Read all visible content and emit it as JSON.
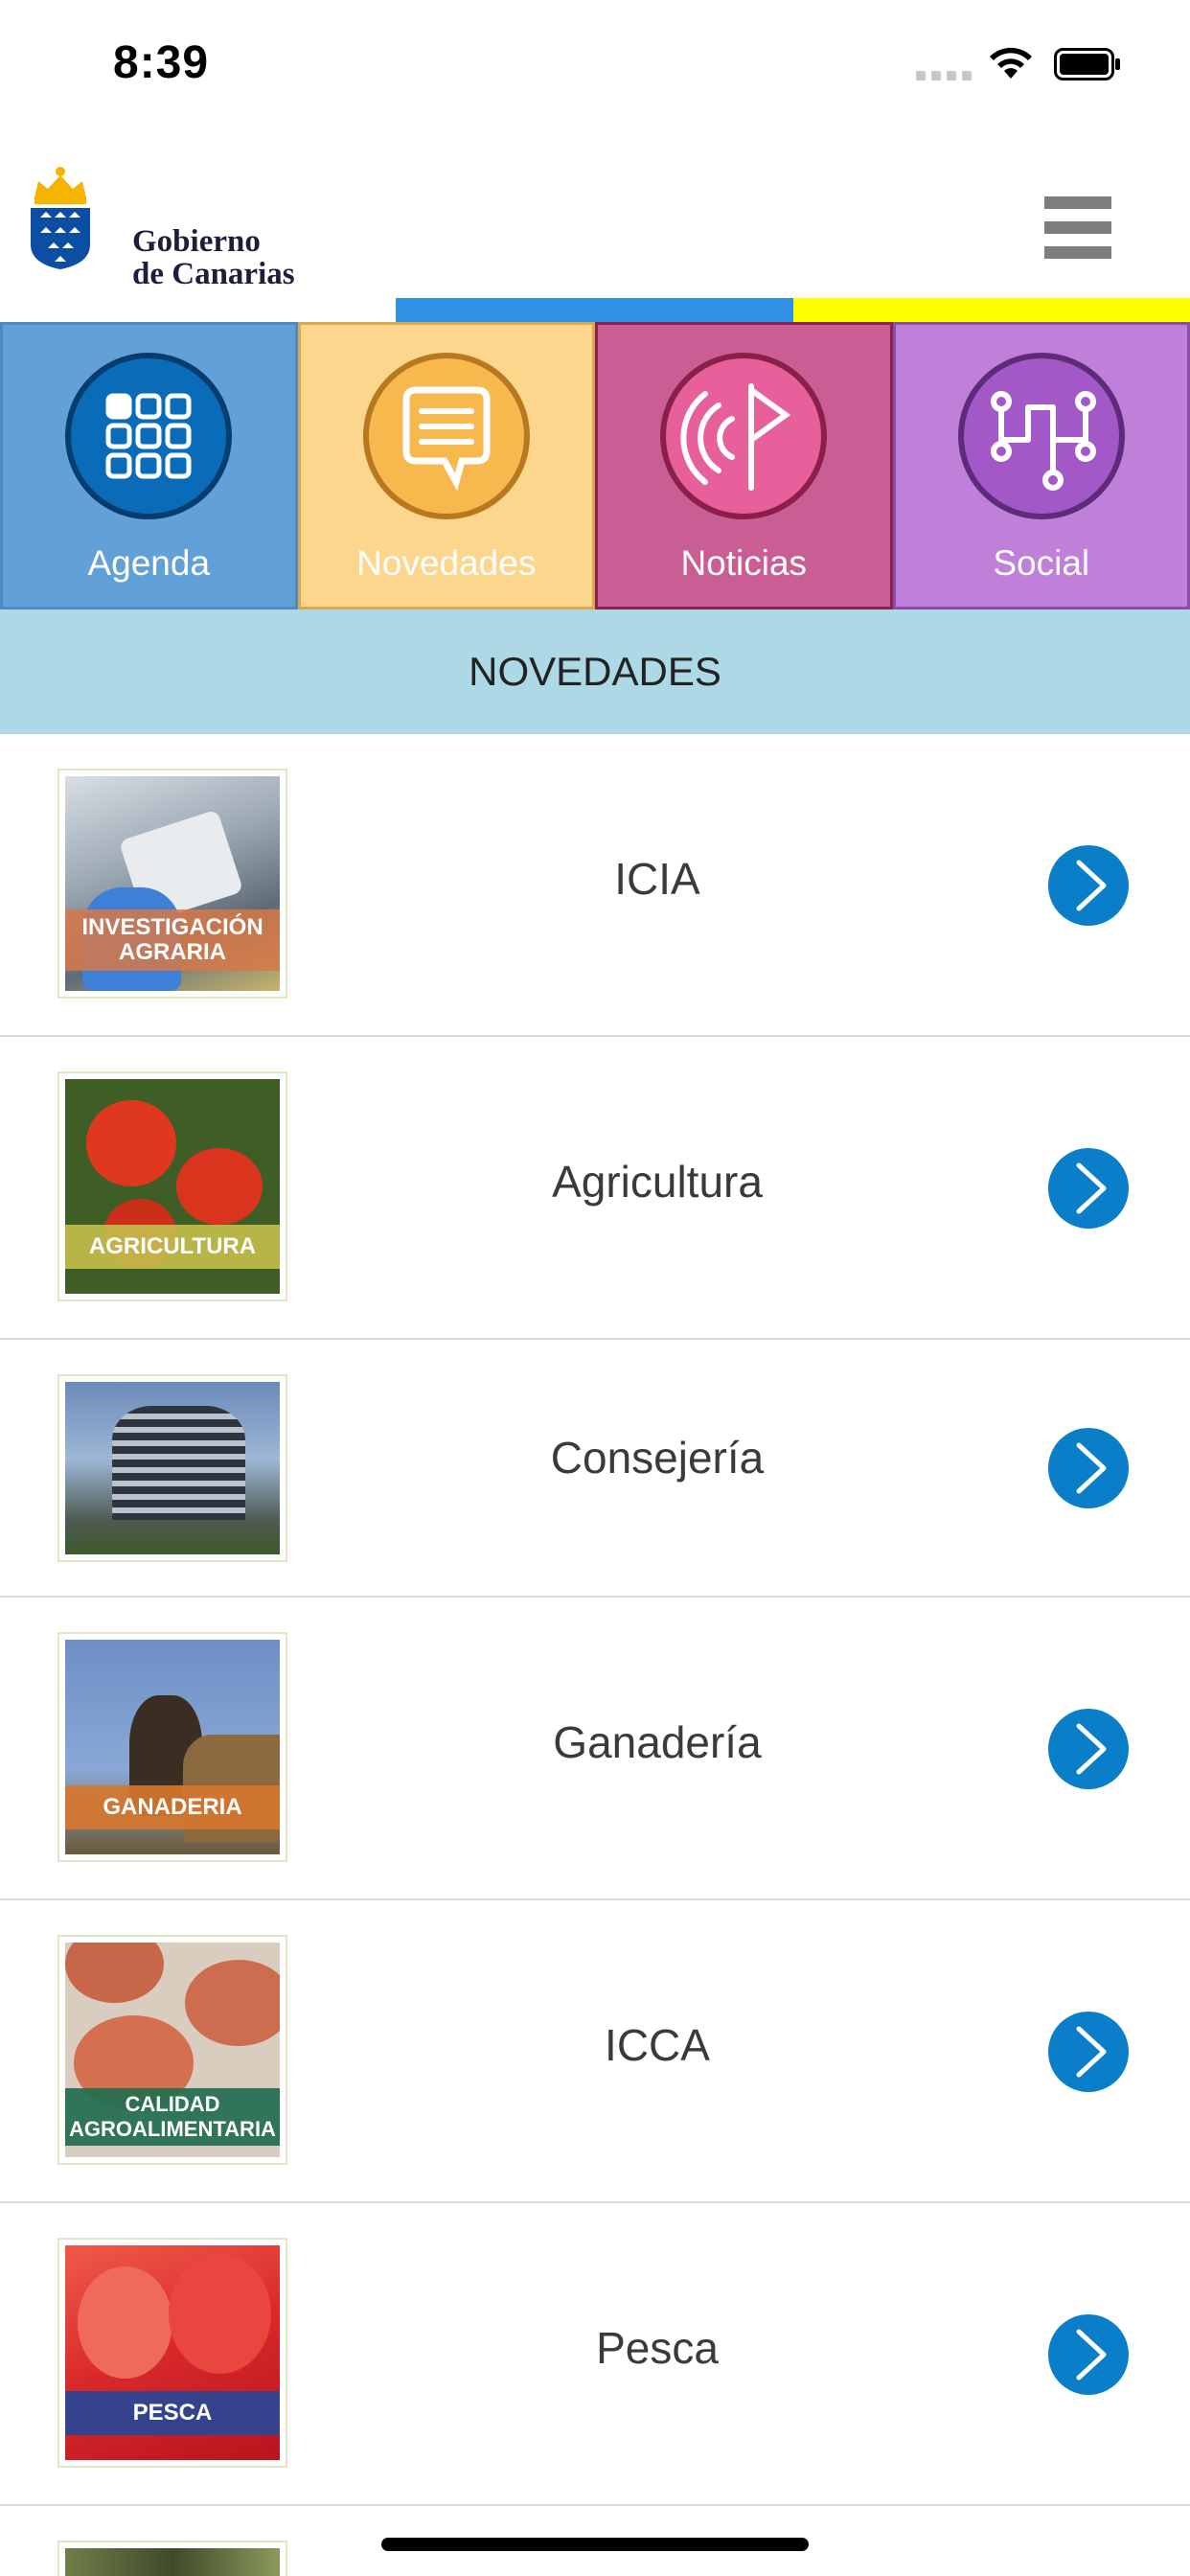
{
  "status_bar": {
    "time": "8:39"
  },
  "header": {
    "logo_line1": "Gobierno",
    "logo_line2": "de Canarias"
  },
  "tabs": [
    {
      "label": "Agenda",
      "icon": "grid-icon",
      "color": "#62a0d8"
    },
    {
      "label": "Novedades",
      "icon": "chat-bubble-icon",
      "color": "#fcd68d"
    },
    {
      "label": "Noticias",
      "icon": "flag-signal-icon",
      "color": "#c95e95"
    },
    {
      "label": "Social",
      "icon": "network-icon",
      "color": "#c07fd8"
    }
  ],
  "section_title": "NOVEDADES",
  "list": [
    {
      "label": "ICIA",
      "thumb_caption": "INVESTIGACIÓN AGRARIA"
    },
    {
      "label": "Agricultura",
      "thumb_caption": "AGRICULTURA"
    },
    {
      "label": "Consejería",
      "thumb_caption": ""
    },
    {
      "label": "Ganadería",
      "thumb_caption": "GANADERIA"
    },
    {
      "label": "ICCA",
      "thumb_caption": "CALIDAD AGROALIMENTARIA"
    },
    {
      "label": "Pesca",
      "thumb_caption": "PESCA"
    }
  ],
  "colors": {
    "accent_blue": "#0a7ec8",
    "stripe_blue": "#2f91e3",
    "stripe_yellow": "#ffff00",
    "section_bg": "#add8e6"
  }
}
